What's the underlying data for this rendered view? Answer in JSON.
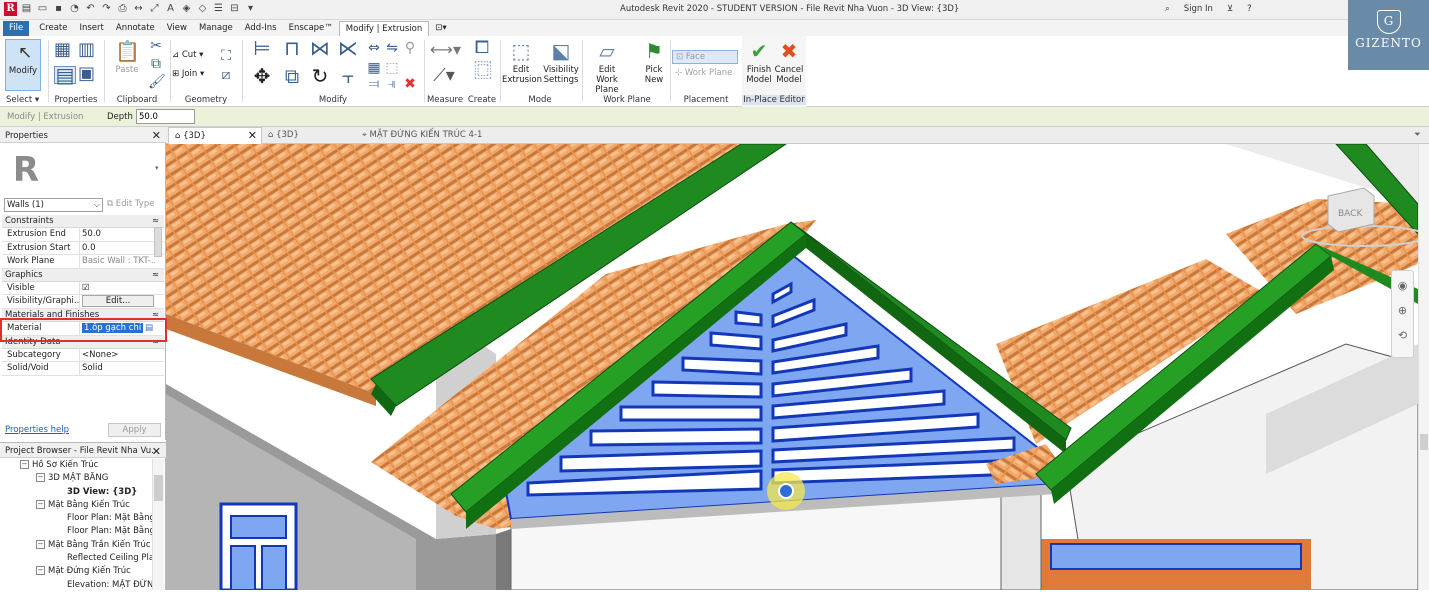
{
  "titlebar": {
    "window_title": "Autodesk Revit 2020 - STUDENT VERSION - File Revit Nha Vuon - 3D View: {3D}",
    "signin": "Sign In",
    "help": "?",
    "watermark": "GIZENTO",
    "watermark_initial": "G"
  },
  "menubar": {
    "file": "File",
    "tabs": [
      "Create",
      "Insert",
      "Annotate",
      "View",
      "Manage",
      "Add-Ins",
      "Enscape™"
    ],
    "active_tab": "Modify | Extrusion"
  },
  "ribbon": {
    "select": {
      "modify": "Modify",
      "label": "Select"
    },
    "properties": {
      "label": "Properties"
    },
    "clipboard": {
      "paste": "Paste",
      "label": "Clipboard"
    },
    "geometry": {
      "cut": "Cut",
      "join": "Join",
      "label": "Geometry"
    },
    "modify": {
      "label": "Modify"
    },
    "measure": {
      "label": "Measure"
    },
    "create": {
      "label": "Create"
    },
    "mode": {
      "edit_extrusion_1": "Edit",
      "edit_extrusion_2": "Extrusion",
      "visibility_1": "Visibility",
      "visibility_2": "Settings",
      "label": "Mode"
    },
    "work_plane": {
      "edit_1": "Edit",
      "edit_2": "Work Plane",
      "pick_1": "Pick",
      "pick_2": "New",
      "label": "Work Plane"
    },
    "placement": {
      "face": "Face",
      "work_plane": "Work Plane",
      "label": "Placement"
    },
    "inplace": {
      "finish_1": "Finish",
      "finish_2": "Model",
      "cancel_1": "Cancel",
      "cancel_2": "Model",
      "label": "In-Place Editor"
    }
  },
  "options_bar": {
    "context": "Modify | Extrusion",
    "depth_label": "Depth",
    "depth_value": "50.0"
  },
  "properties": {
    "title": "Properties",
    "type_letter": "R",
    "type_selector": "Walls (1)",
    "edit_type": "Edit Type",
    "categories": {
      "constraints": "Constraints",
      "graphics": "Graphics",
      "materials": "Materials and Finishes",
      "identity": "Identity Data"
    },
    "rows": {
      "extrusion_end": {
        "k": "Extrusion End",
        "v": "50.0"
      },
      "extrusion_start": {
        "k": "Extrusion Start",
        "v": "0.0"
      },
      "work_plane": {
        "k": "Work Plane",
        "v": "Basic Wall : TKT-..."
      },
      "visible": {
        "k": "Visible",
        "v": "☑"
      },
      "visibility_graphics": {
        "k": "Visibility/Graphi...",
        "v": "Edit..."
      },
      "material": {
        "k": "Material",
        "v": "1.ốp gạch chỉ"
      },
      "subcategory": {
        "k": "Subcategory",
        "v": "<None>"
      },
      "solid_void": {
        "k": "Solid/Void",
        "v": "Solid"
      }
    },
    "help": "Properties help",
    "apply": "Apply"
  },
  "project_browser": {
    "title": "Project Browser - File Revit Nha Vu...",
    "items": [
      {
        "label": "Hồ Sơ Kiến Trúc",
        "toggle": "−"
      },
      {
        "label": "3D MẶT BẰNG",
        "toggle": "−"
      },
      {
        "label": "3D View: {3D}",
        "toggle": ""
      },
      {
        "label": "Mặt Bằng Kiến Trúc",
        "toggle": "−"
      },
      {
        "label": "Floor Plan: Mặt Bằng",
        "toggle": ""
      },
      {
        "label": "Floor Plan: Mặt Bằng",
        "toggle": ""
      },
      {
        "label": "Mặt Bằng Trần Kiến Trúc",
        "toggle": "−"
      },
      {
        "label": "Reflected Ceiling Plan",
        "toggle": ""
      },
      {
        "label": "Mặt Đứng Kiến Trúc",
        "toggle": "−"
      },
      {
        "label": "Elevation: MẶT ĐỨNG",
        "toggle": ""
      }
    ]
  },
  "view_tabs": [
    {
      "label": "{3D}",
      "active": true,
      "closable": true
    },
    {
      "label": "{3D}",
      "active": false,
      "closable": false
    },
    {
      "label": "MẶT ĐỨNG KIẾN TRÚC 4-1",
      "active": false,
      "closable": false
    }
  ],
  "viewcube_label": "BACK",
  "colors": {
    "roof_tile": "#f2a86a",
    "ridge_green": "#1f8a1f",
    "gable_blue": "#7fa6f0",
    "louver_outline": "#1238b8",
    "file_tab": "#2b6fb3",
    "options_bar": "#eaf3d9",
    "highlight_box": "#e0302b",
    "cursor_halo": "#f4e84a"
  }
}
